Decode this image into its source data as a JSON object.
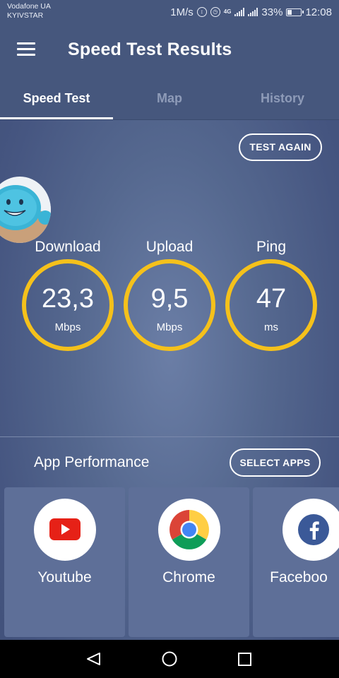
{
  "status_bar": {
    "carrier_line1": "Vodafone UA",
    "carrier_line2": "KYIVSTAR",
    "speed": "1M/s",
    "network": "4G",
    "battery": "33%",
    "time": "12:08"
  },
  "app_bar": {
    "title": "Speed Test Results",
    "menu_icon": "hamburger-menu-icon"
  },
  "tabs": [
    {
      "label": "Speed Test",
      "active": true
    },
    {
      "label": "Map",
      "active": false
    },
    {
      "label": "History",
      "active": false
    }
  ],
  "test_again_label": "TEST AGAIN",
  "metrics": [
    {
      "label": "Download",
      "value": "23,3",
      "unit": "Mbps"
    },
    {
      "label": "Upload",
      "value": "9,5",
      "unit": "Mbps"
    },
    {
      "label": "Ping",
      "value": "47",
      "unit": "ms"
    }
  ],
  "app_performance": {
    "title": "App Performance",
    "select_apps_label": "SELECT APPS",
    "apps": [
      {
        "name": "Youtube",
        "icon": "youtube-icon"
      },
      {
        "name": "Chrome",
        "icon": "chrome-icon"
      },
      {
        "name": "Faceboo",
        "icon": "facebook-icon"
      }
    ]
  },
  "colors": {
    "accent_ring": "#f5c11b",
    "background": "#4a5a80",
    "card": "#5e6f98"
  },
  "nav_bar": {
    "back_icon": "back-triangle-icon",
    "home_icon": "home-circle-icon",
    "recents_icon": "recents-square-icon"
  }
}
